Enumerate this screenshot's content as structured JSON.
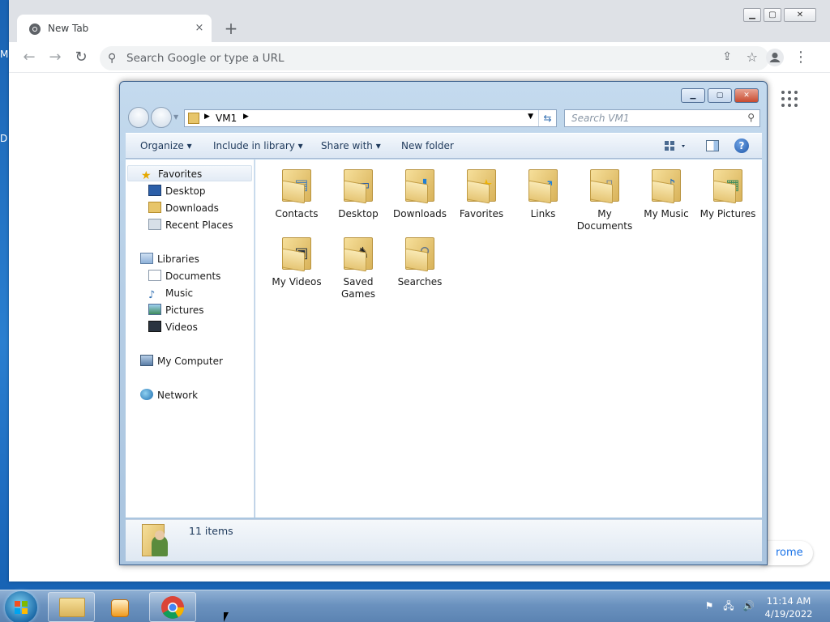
{
  "desktop": {
    "frag1": "M",
    "frag2": "D"
  },
  "chrome": {
    "tab_title": "New Tab",
    "tab_close": "×",
    "new_tab": "+",
    "omnibox_placeholder": "Search Google or type a URL",
    "customize_text": "rome",
    "window_buttons": [
      "▁",
      "▢",
      "✕"
    ]
  },
  "explorer": {
    "breadcrumb": "VM1",
    "search_placeholder": "Search VM1",
    "window_buttons": [
      "▁",
      "▢",
      "✕"
    ],
    "commands": [
      {
        "label": "Organize",
        "dropdown": true
      },
      {
        "label": "Include in library",
        "dropdown": true
      },
      {
        "label": "Share with",
        "dropdown": true
      },
      {
        "label": "New folder",
        "dropdown": false
      }
    ],
    "help": "?",
    "nav": {
      "favorites": "Favorites",
      "favorites_items": [
        "Desktop",
        "Downloads",
        "Recent Places"
      ],
      "libraries": "Libraries",
      "libraries_items": [
        "Documents",
        "Music",
        "Pictures",
        "Videos"
      ],
      "computer": "My Computer",
      "network": "Network"
    },
    "folders": [
      {
        "label": "Contacts",
        "glyph": "contacts-icon"
      },
      {
        "label": "Desktop",
        "glyph": "desktop-icon"
      },
      {
        "label": "Downloads",
        "glyph": "download-arrow-icon"
      },
      {
        "label": "Favorites",
        "glyph": "star-icon"
      },
      {
        "label": "Links",
        "glyph": "link-arrow-icon"
      },
      {
        "label": "My Documents",
        "glyph": "document-icon"
      },
      {
        "label": "My Music",
        "glyph": "music-note-icon"
      },
      {
        "label": "My Pictures",
        "glyph": "picture-icon"
      },
      {
        "label": "My Videos",
        "glyph": "film-icon"
      },
      {
        "label": "Saved Games",
        "glyph": "chess-piece-icon"
      },
      {
        "label": "Searches",
        "glyph": "magnifier-icon"
      }
    ],
    "status": "11 items"
  },
  "taskbar": {
    "time": "11:14 AM",
    "date": "4/19/2022"
  },
  "colors": {
    "accent": "#1a73e8",
    "explorer_frame": "#b7cfe6",
    "taskbar": "#6b92bf"
  }
}
